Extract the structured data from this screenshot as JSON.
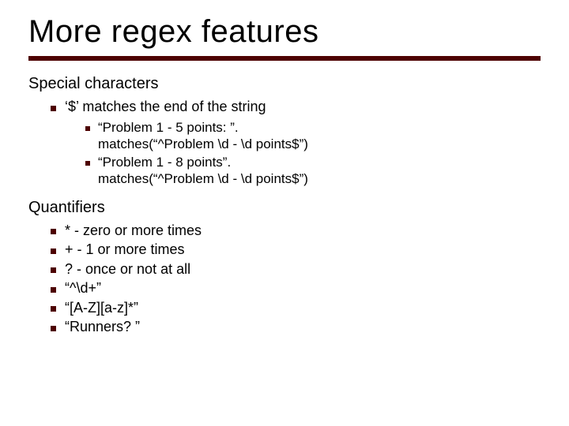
{
  "title": "More regex features",
  "sections": [
    {
      "heading": "Special characters",
      "items": [
        {
          "text": "‘$’ matches the end of the string",
          "sub": [
            {
              "text": "“Problem 1 - 5 points: ”.\nmatches(“^Problem \\d - \\d points$”)"
            },
            {
              "text": "“Problem 1 - 8 points”.\nmatches(“^Problem \\d - \\d points$”)"
            }
          ]
        }
      ]
    },
    {
      "heading": "Quantifiers",
      "items": [
        {
          "text": "* - zero or more times"
        },
        {
          "text": "+ - 1 or more times"
        },
        {
          "text": "? - once or not at all"
        },
        {
          "text": "“^\\d+”"
        },
        {
          "text": "“[A-Z][a-z]*”"
        },
        {
          "text": "“Runners? ”"
        }
      ]
    }
  ]
}
